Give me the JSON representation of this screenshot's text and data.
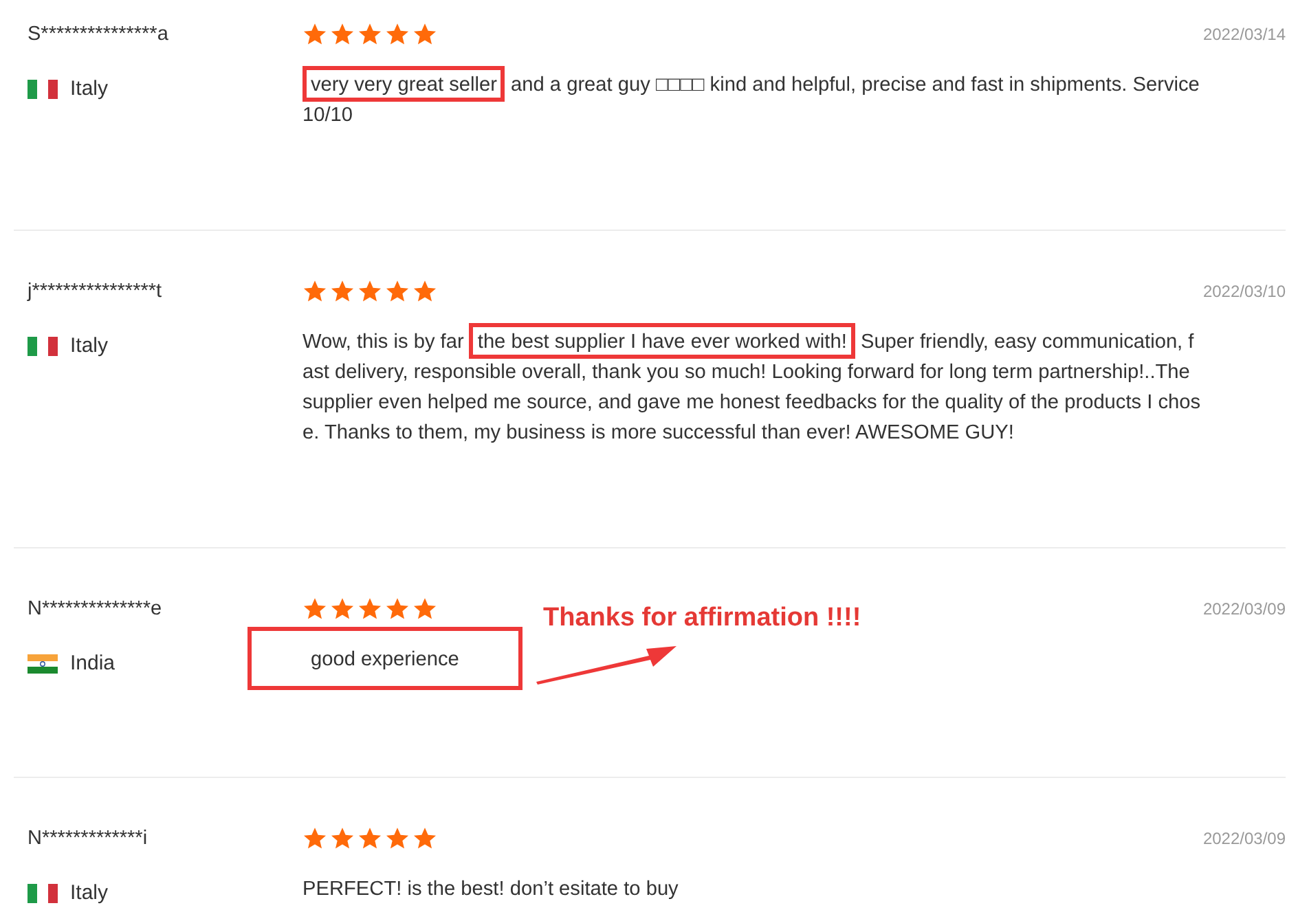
{
  "reviews": [
    {
      "name": "S***************a",
      "flag": {
        "kind": "it"
      },
      "country": "Italy",
      "stars": 5,
      "date": "2022/03/14",
      "segments": [
        {
          "text": "very very great seller",
          "highlighted": true
        },
        {
          "text": " and a great guy □□□□ kind and helpful, precise and fast in shipments. Service 10/10",
          "highlighted": false
        }
      ]
    },
    {
      "name": "j****************t",
      "flag": {
        "kind": "it"
      },
      "country": "Italy",
      "stars": 5,
      "date": "2022/03/10",
      "segments": [
        {
          "text": "Wow, this is by far ",
          "highlighted": false
        },
        {
          "text": "the best supplier I have ever worked with!",
          "highlighted": true
        },
        {
          "text": " Super friendly, easy communication, fast delivery, responsible overall, thank you so much! Looking forward for long term partnership!..The supplier even helped me source, and gave me honest feedbacks for the quality of the products I chose. Thanks to them, my business is more successful than ever! AWESOME GUY!",
          "highlighted": false
        }
      ]
    },
    {
      "name": "N**************e",
      "flag": {
        "kind": "in"
      },
      "country": "India",
      "stars": 5,
      "date": "2022/03/09",
      "segments": [
        {
          "text": "good experience",
          "highlighted": true
        }
      ],
      "annotation": "Thanks for affirmation !!!!"
    },
    {
      "name": "N*************i",
      "flag": {
        "kind": "it"
      },
      "country": "Italy",
      "stars": 5,
      "date": "2022/03/09",
      "segments": [
        {
          "text": "PERFECT! is the best! don’t esitate to buy",
          "highlighted": false
        }
      ]
    }
  ]
}
